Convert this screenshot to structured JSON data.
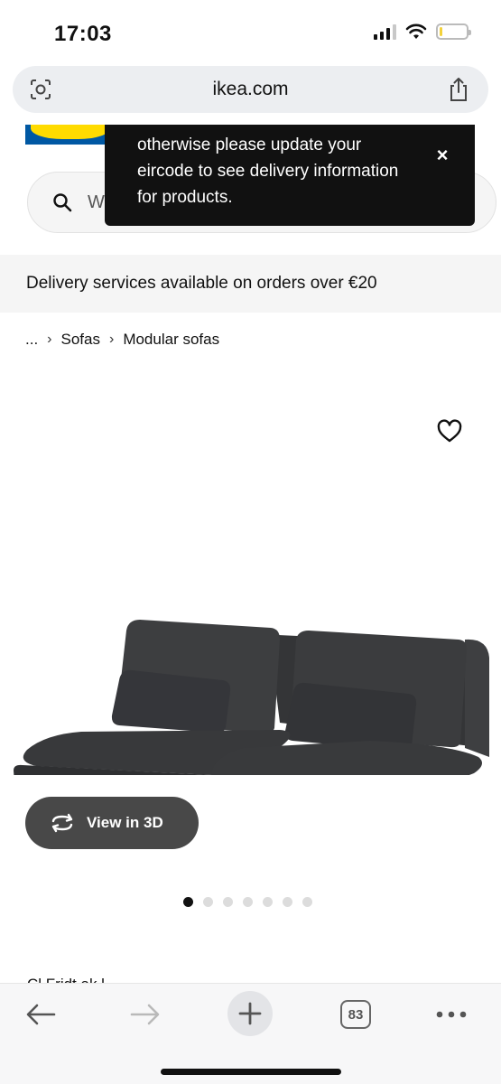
{
  "status_bar": {
    "time": "17:03",
    "icons": [
      "cellular-signal-icon",
      "wifi-icon",
      "battery-icon"
    ]
  },
  "browser": {
    "url": "ikea.com",
    "left_icon": "lens-search-icon",
    "right_icon": "share-icon"
  },
  "page": {
    "search": {
      "placeholder": "W"
    },
    "toast": {
      "message": "otherwise please update your eircode to see delivery information for products.",
      "close": "×"
    },
    "delivery_banner": "Delivery services available on orders over €20",
    "breadcrumb": {
      "ellipsis": "...",
      "separator": "›",
      "items": [
        "Sofas",
        "Modular sofas"
      ]
    },
    "view_3d_label": "View in 3D",
    "carousel": {
      "total": 7,
      "active_index": 0
    },
    "cut_off_text": "Cl          Fridt    ak  l"
  },
  "bottom_toolbar": {
    "tab_count": "83",
    "icons": [
      "back-arrow-icon",
      "forward-arrow-icon",
      "plus-icon",
      "tabs-icon",
      "more-icon"
    ]
  },
  "colors": {
    "ikea_blue": "#0058a3",
    "ikea_yellow": "#ffdb00",
    "toast_bg": "#111111",
    "view3d_bg": "#484848",
    "sofa": "#3b3c3e"
  }
}
